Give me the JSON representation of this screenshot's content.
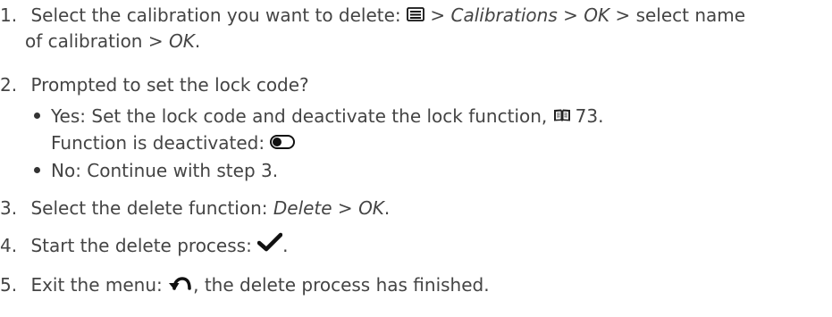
{
  "steps": [
    {
      "number": "1.",
      "line1": {
        "text_before": "Select the calibration you want to delete: ",
        "sep1": " > ",
        "calibrations": "Calibrations",
        "sep2": " > ",
        "ok": "OK",
        "text_after": " > select name"
      },
      "line2": {
        "text_before": "of calibration > ",
        "ok": "OK",
        "period": "."
      }
    },
    {
      "number": "2.",
      "text": "Prompted to set the lock code?",
      "bullets": [
        {
          "line1_text": "Yes: Set the lock code and deactivate the lock function, ",
          "page_ref": "73",
          "period": ".",
          "line2_text": "Function is deactivated: "
        },
        {
          "line1_text": "No: Continue with step 3."
        }
      ]
    },
    {
      "number": "3.",
      "text_before": "Select the delete function: ",
      "delete": "Delete",
      "sep": " > ",
      "ok": "OK",
      "period": "."
    },
    {
      "number": "4.",
      "text_before": "Start the delete process: ",
      "period": "."
    },
    {
      "number": "5.",
      "text_before": "Exit the menu: ",
      "text_after": ", the delete process has finished."
    }
  ],
  "icons": {
    "menu": "menu-icon",
    "book": "book-icon",
    "toggle": "toggle-off-icon",
    "check": "checkmark-icon",
    "back": "back-arrow-icon"
  },
  "colors": {
    "text": "#444444",
    "icon": "#111111"
  }
}
